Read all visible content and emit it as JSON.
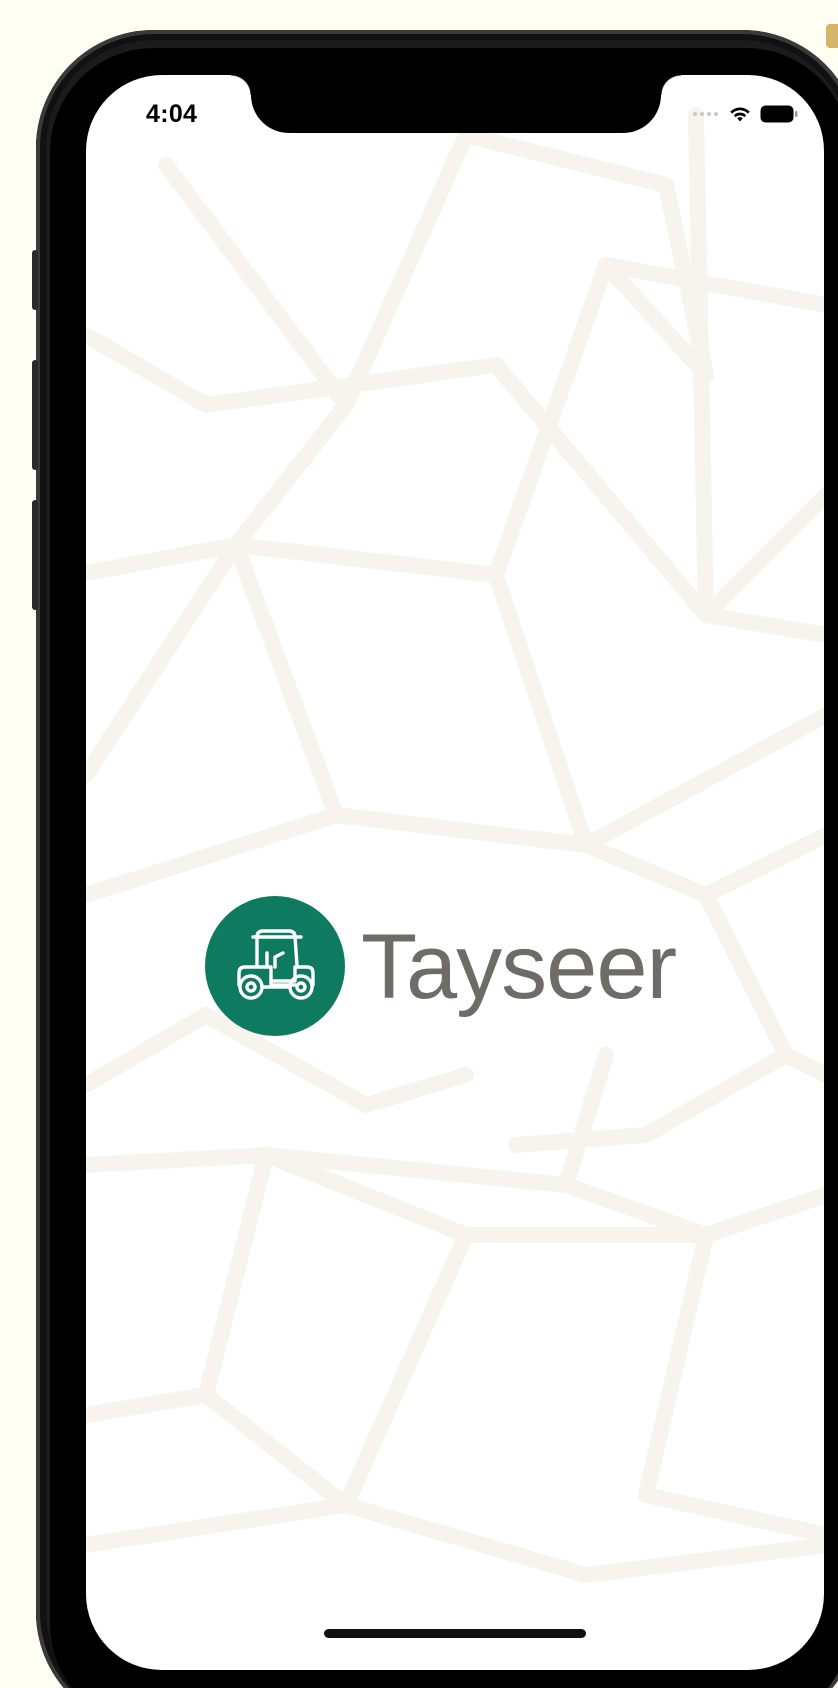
{
  "status_bar": {
    "time": "4:04",
    "icons": [
      "signal-dots-icon",
      "wifi-icon",
      "battery-icon"
    ]
  },
  "splash": {
    "app_name": "Tayseer",
    "logo_icon": "golf-cart-icon"
  },
  "colors": {
    "brand_green": "#0E7A5F",
    "wordmark_gray": "#6F6C67",
    "desktop_background": "#FFFEF3",
    "pattern_stroke": "#F6F4EC"
  }
}
